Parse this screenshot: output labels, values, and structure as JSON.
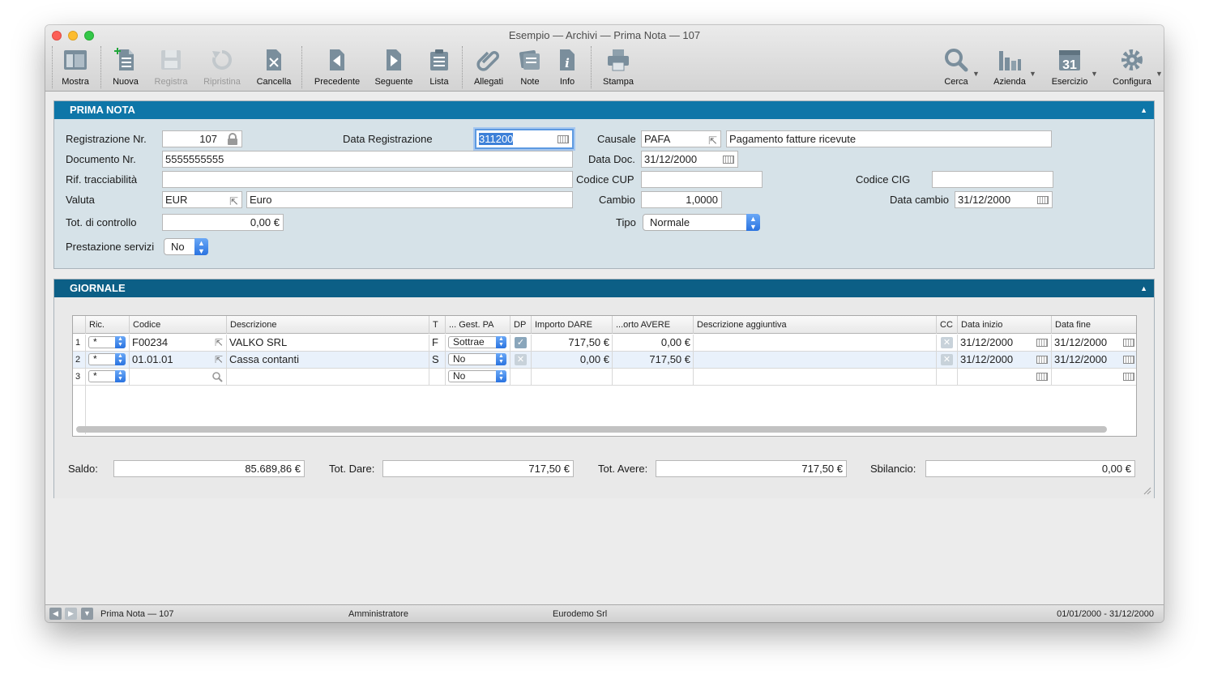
{
  "window": {
    "title": "Esempio — Archivi — Prima Nota — 107"
  },
  "toolbar": {
    "mostra": "Mostra",
    "nuova": "Nuova",
    "registra": "Registra",
    "ripristina": "Ripristina",
    "cancella": "Cancella",
    "precedente": "Precedente",
    "seguente": "Seguente",
    "lista": "Lista",
    "allegati": "Allegati",
    "note": "Note",
    "info": "Info",
    "stampa": "Stampa",
    "cerca": "Cerca",
    "azienda": "Azienda",
    "esercizio": "Esercizio",
    "esercizio_day": "31",
    "configura": "Configura"
  },
  "prima_nota": {
    "header": "PRIMA NOTA",
    "reg_nr_label": "Registrazione Nr.",
    "reg_nr": "107",
    "data_reg_label": "Data Registrazione",
    "data_reg": "311200",
    "causale_label": "Causale",
    "causale_code": "PAFA",
    "causale_desc": "Pagamento fatture ricevute",
    "doc_nr_label": "Documento Nr.",
    "doc_nr": "5555555555",
    "data_doc_label": "Data Doc.",
    "data_doc": "31/12/2000",
    "rif_label": "Rif. tracciabilità",
    "rif": "",
    "cup_label": "Codice CUP",
    "cup": "",
    "cig_label": "Codice CIG",
    "cig": "",
    "valuta_label": "Valuta",
    "valuta_code": "EUR",
    "valuta_desc": "Euro",
    "cambio_label": "Cambio",
    "cambio": "1,0000",
    "data_cambio_label": "Data cambio",
    "data_cambio": "31/12/2000",
    "tot_label": "Tot. di controllo",
    "tot": "0,00 €",
    "tipo_label": "Tipo",
    "tipo": "Normale",
    "prest_label": "Prestazione servizi",
    "prest": "No"
  },
  "giornale": {
    "header": "GIORNALE",
    "columns": [
      "Ric.",
      "Codice",
      "Descrizione",
      "T",
      "... Gest. PA",
      "DP",
      "Importo DARE",
      "...orto AVERE",
      "Descrizione aggiuntiva",
      "CC",
      "Data inizio",
      "Data fine"
    ],
    "rows": [
      {
        "n": "1",
        "ric": "*",
        "codice": "F00234",
        "descrizione": "VALKO SRL",
        "t": "F",
        "gest": "Sottrae",
        "dp": true,
        "dare": "717,50 €",
        "avere": "0,00 €",
        "agg": "",
        "cc": false,
        "inizio": "31/12/2000",
        "fine": "31/12/2000"
      },
      {
        "n": "2",
        "ric": "*",
        "codice": "01.01.01",
        "descrizione": "Cassa contanti",
        "t": "S",
        "gest": "No",
        "dp": false,
        "dare": "0,00 €",
        "avere": "717,50 €",
        "agg": "",
        "cc": false,
        "inizio": "31/12/2000",
        "fine": "31/12/2000"
      },
      {
        "n": "3",
        "ric": "*",
        "codice": "",
        "descrizione": "",
        "t": "",
        "gest": "No",
        "dp": null,
        "dare": "",
        "avere": "",
        "agg": "",
        "cc": null,
        "inizio": "",
        "fine": ""
      }
    ],
    "saldo_label": "Saldo:",
    "saldo": "85.689,86 €",
    "dare_label": "Tot. Dare:",
    "dare": "717,50 €",
    "avere_label": "Tot. Avere:",
    "avere": "717,50 €",
    "sbil_label": "Sbilancio:",
    "sbil": "0,00 €"
  },
  "status": {
    "record": "Prima Nota — 107",
    "user": "Amministratore",
    "company": "Eurodemo Srl",
    "period": "01/01/2000 - 31/12/2000"
  }
}
